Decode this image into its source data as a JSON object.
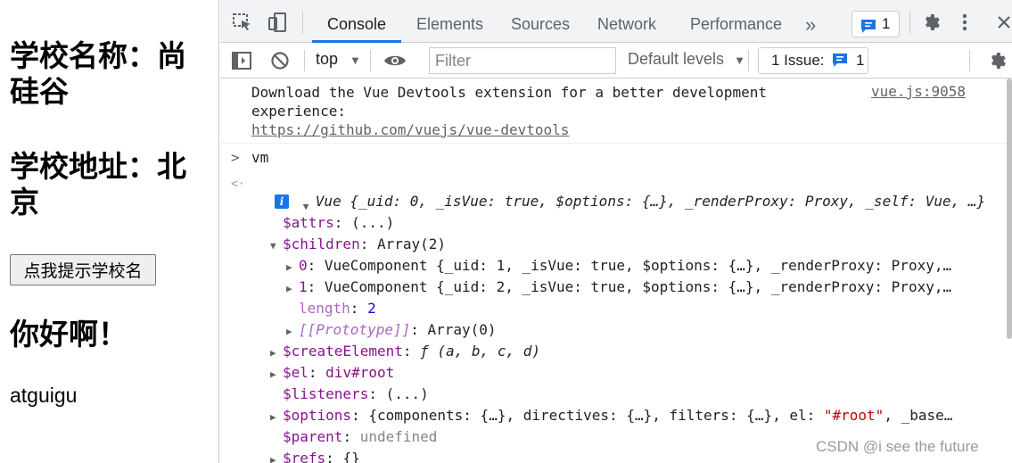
{
  "page": {
    "school_name": "学校名称：尚硅谷",
    "school_addr": "学校地址：北京",
    "hint_button": "点我提示学校名",
    "hello": "你好啊！",
    "student_name": "atguigu"
  },
  "devtools": {
    "tabs": [
      "Console",
      "Elements",
      "Sources",
      "Network",
      "Performance"
    ],
    "more_tabs": "»",
    "messages_count": "1",
    "toolbar": {
      "context": "top",
      "filter_placeholder": "Filter",
      "levels": "Default levels",
      "issues_label": "1 Issue:",
      "issues_count": "1"
    },
    "console": {
      "devtools_msg": "Download the Vue Devtools extension for a better development experience:",
      "devtools_link": "https://github.com/vuejs/vue-devtools",
      "devtools_source": "vue.js:9058",
      "input_cmd": "vm",
      "result_summary_prefix": "Vue ",
      "result_summary": "{_uid: 0, _isVue: true, $options: {…}, _renderProxy: Proxy, _self: Vue, …}",
      "info_badge": "i",
      "rows": {
        "attrs_key": "$attrs",
        "attrs_val": "(...)",
        "children_key": "$children",
        "children_val": "Array(2)",
        "child0_key": "0",
        "child0_val": "VueComponent {_uid: 1, _isVue: true, $options: {…}, _renderProxy: Proxy,…",
        "child1_key": "1",
        "child1_val": "VueComponent {_uid: 2, _isVue: true, $options: {…}, _renderProxy: Proxy,…",
        "length_key": "length",
        "length_val": "2",
        "proto_key": "[[Prototype]]",
        "proto_val": "Array(0)",
        "create_key": "$createElement",
        "create_val": "ƒ (a, b, c, d)",
        "el_key": "$el",
        "el_val": "div#root",
        "listeners_key": "$listeners",
        "listeners_val": "(...)",
        "options_key": "$options",
        "options_val_a": "{components: {…}, directives: {…}, filters: {…}, el: ",
        "options_val_str": "\"#root\"",
        "options_val_b": ", _base…",
        "parent_key": "$parent",
        "parent_val": "undefined",
        "refs_key": "$refs",
        "refs_val": "{}"
      }
    }
  },
  "watermark": "CSDN @i see the future"
}
